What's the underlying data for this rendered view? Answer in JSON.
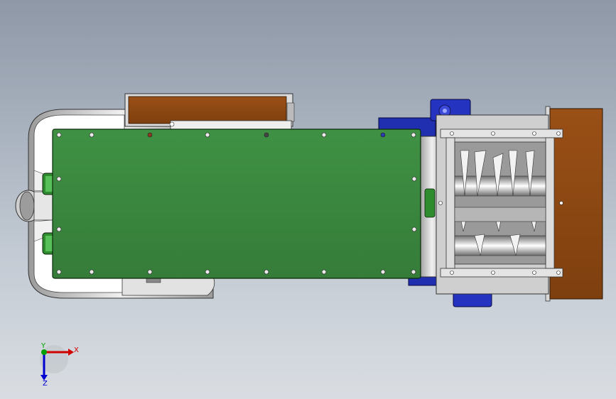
{
  "view": {
    "background_top": "#8e98a6",
    "background_bottom": "#d9dde2"
  },
  "model": {
    "plate_color": "#3b8a3e",
    "motor_box_color": "#8b4513",
    "drive_color": "#1f2fb0",
    "frame_color": "#c8c8c8"
  },
  "triad": {
    "x_label": "X",
    "y_label": "Y",
    "z_label": "Z",
    "x_color": "#d00000",
    "y_color": "#00a000",
    "z_color": "#0000d0"
  }
}
